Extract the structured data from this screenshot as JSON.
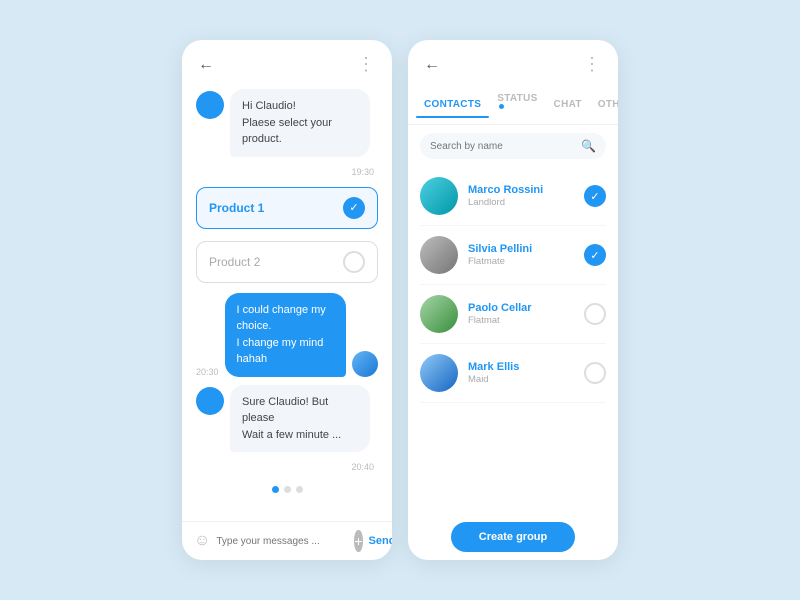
{
  "chat": {
    "back_label": "←",
    "more_label": "⋮",
    "messages": [
      {
        "type": "received",
        "text": "Hi Claudio!\nPlaese select your product.",
        "time": "19:30"
      }
    ],
    "product1_label": "Product 1",
    "product2_label": "Product 2",
    "sent_message": "I could change my choice.\nI change my mind hahah",
    "sent_time": "20:30",
    "received_message2": "Sure Claudio! But please\nWait a few minutes ...",
    "received_time2": "20:40",
    "input_placeholder": "Type your messages ...",
    "send_label": "Send"
  },
  "contacts": {
    "back_label": "←",
    "more_label": "⋮",
    "tabs": [
      {
        "label": "CONTACTS",
        "active": true,
        "badge": false
      },
      {
        "label": "STATUS",
        "active": false,
        "badge": true
      },
      {
        "label": "CHAT",
        "active": false,
        "badge": false
      },
      {
        "label": "OTHERS",
        "active": false,
        "badge": false
      }
    ],
    "search_placeholder": "Search by name",
    "contacts_list": [
      {
        "name": "Marco Rossini",
        "role": "Landlord",
        "selected": true,
        "color": "ca-teal"
      },
      {
        "name": "Silvia Pellini",
        "role": "Flatmate",
        "selected": true,
        "color": "ca-gray"
      },
      {
        "name": "Paolo Cellar",
        "role": "Flatmat",
        "selected": false,
        "color": "ca-stone"
      },
      {
        "name": "Mark Ellis",
        "role": "Maid",
        "selected": false,
        "color": "ca-blue"
      }
    ],
    "create_group_label": "Create group"
  }
}
